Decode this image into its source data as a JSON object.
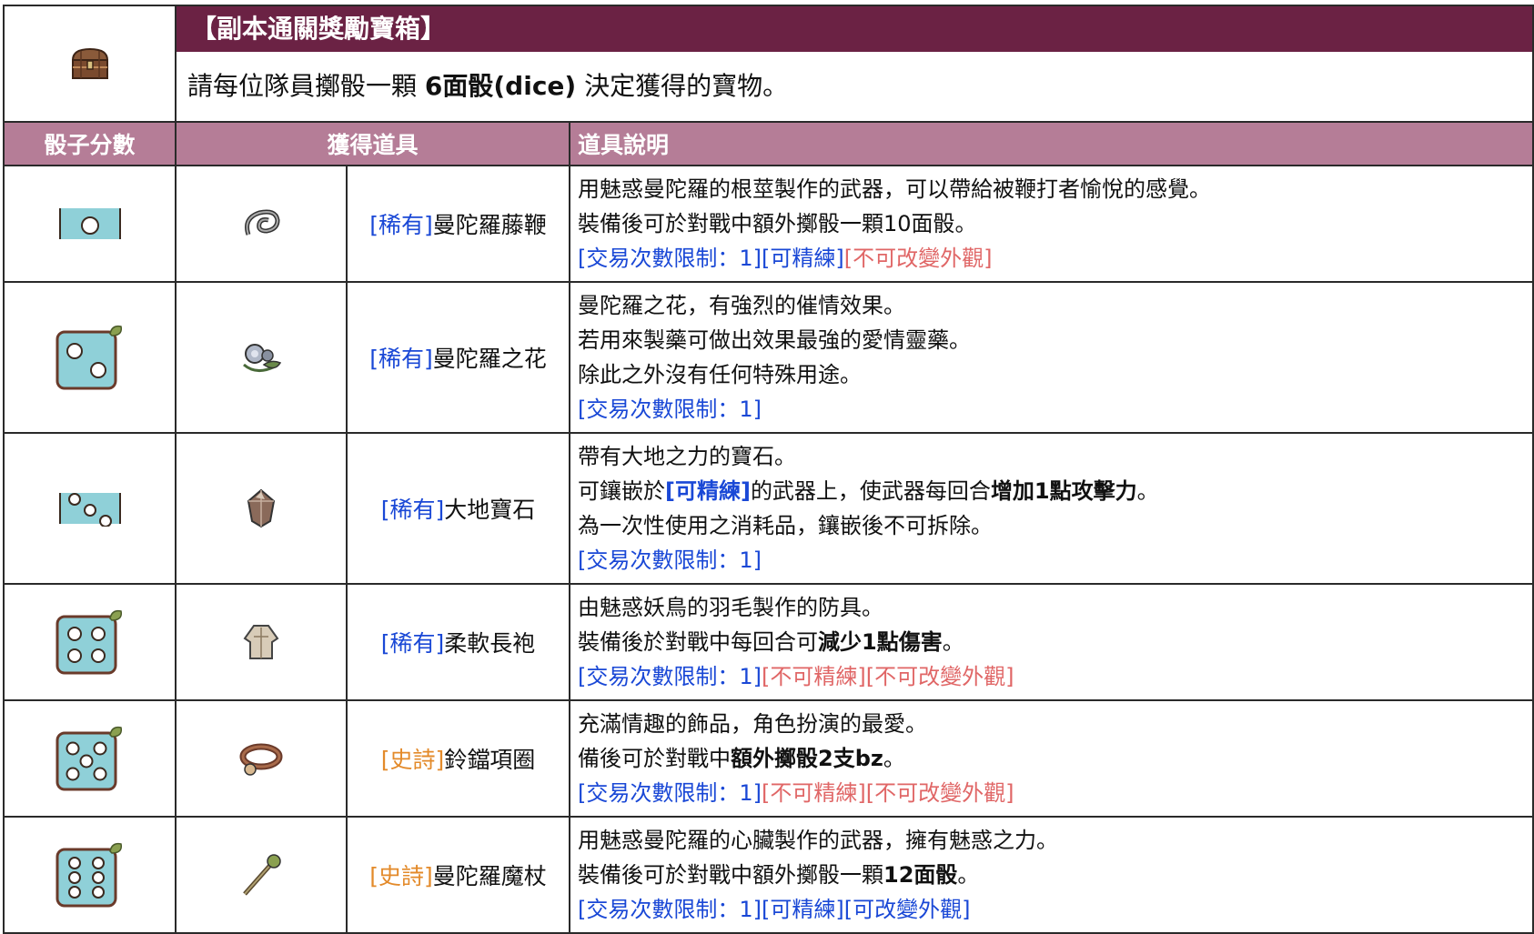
{
  "header": {
    "title": "【副本通關獎勵寶箱】",
    "subtitle_before": "請每位隊員擲骰一顆 ",
    "subtitle_bold": "6面骰(dice)",
    "subtitle_after": " 決定獲得的寶物。",
    "chest_icon": "treasure-chest-icon"
  },
  "columns": {
    "dice": "骰子分數",
    "item": "獲得道具",
    "desc": "道具說明"
  },
  "colors": {
    "title_bar": "#6b2244",
    "header_row": "#b57d97",
    "dice_face": "#8fd0d8",
    "rare": "#1a48d6",
    "epic": "#e38a2a",
    "restriction_negative": "#e06666"
  },
  "rows": [
    {
      "dice_value": 1,
      "dice_icon": "dice-1-icon",
      "item_icon": "whip-icon",
      "rarity": "[稀有]",
      "name": "曼陀羅藤鞭",
      "lines": [
        "用魅惑曼陀羅的根莖製作的武器，可以帶給被鞭打者愉悅的感覺。",
        "裝備後可於對戰中額外擲骰一顆10面骰。"
      ],
      "tags": [
        {
          "text": "[交易次數限制：1]",
          "color": "blue"
        },
        {
          "text": "[可精練]",
          "color": "blue"
        },
        {
          "text": "[不可改變外觀]",
          "color": "red"
        }
      ]
    },
    {
      "dice_value": 2,
      "dice_icon": "dice-2-icon",
      "item_icon": "flower-icon",
      "rarity": "[稀有]",
      "name": "曼陀羅之花",
      "lines": [
        "曼陀羅之花，有強烈的催情效果。",
        "若用來製藥可做出效果最強的愛情靈藥。",
        "除此之外沒有任何特殊用途。"
      ],
      "tags": [
        {
          "text": "[交易次數限制：1]",
          "color": "blue"
        }
      ]
    },
    {
      "dice_value": 3,
      "dice_icon": "dice-3-icon",
      "item_icon": "gem-icon",
      "rarity": "[稀有]",
      "name": "大地寶石",
      "line1": "帶有大地之力的寶石。",
      "line2_a": "可鑲嵌於",
      "line2_b": "[可精練]",
      "line2_c": "的武器上，使武器每回合",
      "line2_d": "增加1點攻擊力",
      "line2_e": "。",
      "line3": "為一次性使用之消耗品，鑲嵌後不可拆除。",
      "tag1": "[交易次數限制：1]"
    },
    {
      "dice_value": 4,
      "dice_icon": "dice-4-icon",
      "item_icon": "robe-icon",
      "rarity": "[稀有]",
      "name": "柔軟長袍",
      "line1": "由魅惑妖鳥的羽毛製作的防具。",
      "line2_a": "裝備後於對戰中每回合可",
      "line2_b": "減少1點傷害",
      "line2_c": "。",
      "tag1": "[交易次數限制：1]",
      "tag2": "[不可精練]",
      "tag3": "[不可改變外觀]"
    },
    {
      "dice_value": 5,
      "dice_icon": "dice-5-icon",
      "item_icon": "collar-icon",
      "rarity": "[史詩]",
      "name": "鈴鐺項圈",
      "line1": "充滿情趣的飾品，角色扮演的最愛。",
      "line2_a": "備後可於對戰中",
      "line2_b": "額外擲骰2支bz",
      "line2_c": "。",
      "tag1": "[交易次數限制：1]",
      "tag2": "[不可精練]",
      "tag3": "[不可改變外觀]"
    },
    {
      "dice_value": 6,
      "dice_icon": "dice-6-icon",
      "item_icon": "staff-icon",
      "rarity": "[史詩]",
      "name": "曼陀羅魔杖",
      "line1": "用魅惑曼陀羅的心臟製作的武器，擁有魅惑之力。",
      "line2_a": "裝備後可於對戰中額外擲骰一顆",
      "line2_b": "12面骰",
      "line2_c": "。",
      "tag1": "[交易次數限制：1]",
      "tag2": "[可精練]",
      "tag3": "[可改變外觀]"
    }
  ]
}
